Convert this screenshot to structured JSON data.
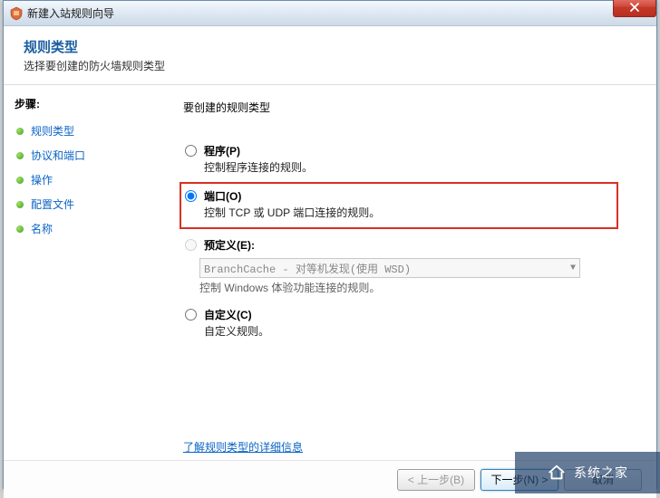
{
  "window": {
    "title": "新建入站规则向导"
  },
  "header": {
    "title": "规则类型",
    "subtitle": "选择要创建的防火墙规则类型"
  },
  "sidebar": {
    "steps_label": "步骤:",
    "items": [
      {
        "label": "规则类型",
        "current": true
      },
      {
        "label": "协议和端口"
      },
      {
        "label": "操作"
      },
      {
        "label": "配置文件"
      },
      {
        "label": "名称"
      }
    ]
  },
  "main": {
    "title": "要创建的规则类型",
    "options": {
      "program": {
        "label": "程序(P)",
        "desc": "控制程序连接的规则。"
      },
      "port": {
        "label": "端口(O)",
        "desc": "控制 TCP 或 UDP 端口连接的规则。"
      },
      "predefined": {
        "label": "预定义(E):",
        "combo_value": "BranchCache - 对等机发现(使用 WSD)",
        "desc": "控制 Windows 体验功能连接的规则。"
      },
      "custom": {
        "label": "自定义(C)",
        "desc": "自定义规则。"
      }
    },
    "link_more": "了解规则类型的详细信息"
  },
  "footer": {
    "back": "< 上一步(B)",
    "next": "下一步(N) >",
    "cancel": "取消"
  },
  "watermark": {
    "text": "系统之家"
  }
}
